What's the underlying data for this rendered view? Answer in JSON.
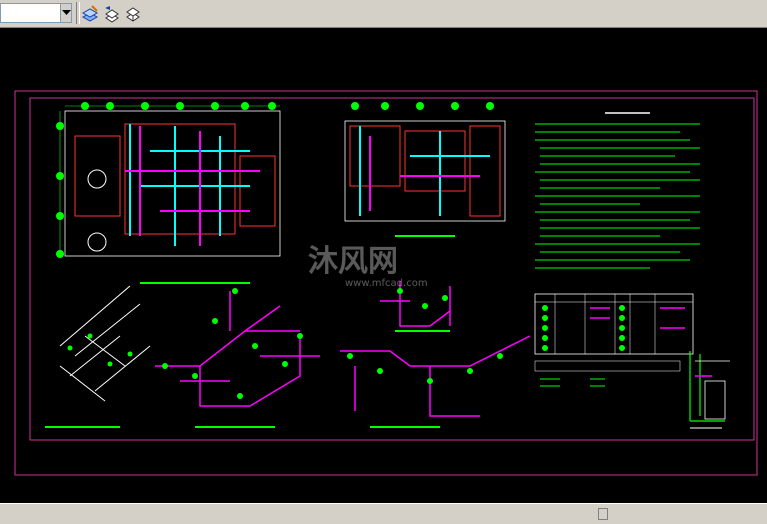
{
  "toolbar": {
    "layer_combo_value": "",
    "buttons": [
      "layer-properties",
      "layer-previous",
      "layer-states"
    ]
  },
  "drawing": {
    "background": "#000000",
    "frame_color": "#cc3399",
    "line_colors": [
      "#00ff00",
      "#ff00ff",
      "#00ffff",
      "#ffffff",
      "#ff3333",
      "#ffff00"
    ]
  },
  "watermark": {
    "brand": "沐风网",
    "url": "www.mfcad.com"
  }
}
